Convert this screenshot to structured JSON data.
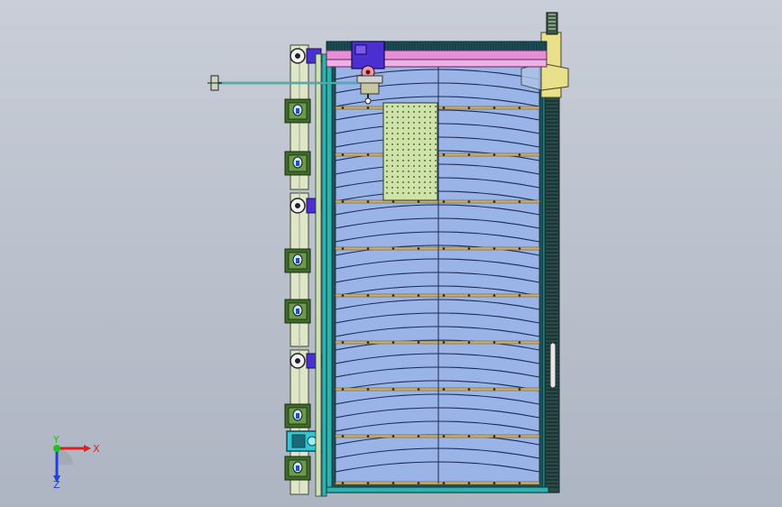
{
  "viewport": {
    "background_top": "#c9ced8",
    "background_bottom": "#aeb5c2"
  },
  "colors": {
    "panel_fill": "#9ab4e8",
    "panel_stroke": "#1b2a55",
    "frame_teal": "#2fb3b0",
    "frame_dark": "#1f4f58",
    "rail_green": "#7a9a55",
    "clamp_green": "#3f6b2c",
    "pink_beam": "#e68fd6",
    "purple_block": "#4b2fd0",
    "yellow_column": "#e8e08a",
    "slat_tan": "#c8b07a",
    "cyan_device": "#30c8d8",
    "side_support": "#dfe6c8"
  },
  "icons": {
    "axis_triad": "xyz-axis-triad-icon",
    "crane_hook": "hoist-hook-icon",
    "side_clamp": "clamp-icon",
    "roller": "roller-icon"
  },
  "triad": {
    "x_label": "X",
    "y_label": "Y",
    "z_label": "Z",
    "x_color": "#e02020",
    "y_color": "#20c020",
    "z_color": "#2040e0"
  }
}
